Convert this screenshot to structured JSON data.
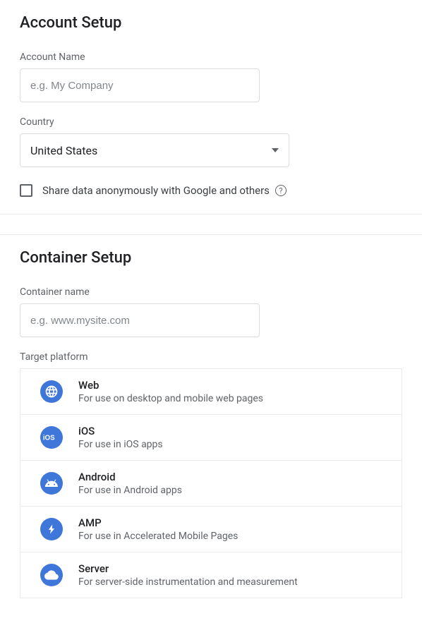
{
  "account": {
    "title": "Account Setup",
    "name_label": "Account Name",
    "name_placeholder": "e.g. My Company",
    "country_label": "Country",
    "country_value": "United States",
    "share_label": "Share data anonymously with Google and others"
  },
  "container": {
    "title": "Container Setup",
    "name_label": "Container name",
    "name_placeholder": "e.g. www.mysite.com",
    "platform_label": "Target platform",
    "platforms": [
      {
        "name": "Web",
        "desc": "For use on desktop and mobile web pages"
      },
      {
        "name": "iOS",
        "desc": "For use in iOS apps"
      },
      {
        "name": "Android",
        "desc": "For use in Android apps"
      },
      {
        "name": "AMP",
        "desc": "For use in Accelerated Mobile Pages"
      },
      {
        "name": "Server",
        "desc": "For server-side instrumentation and measurement"
      }
    ]
  }
}
